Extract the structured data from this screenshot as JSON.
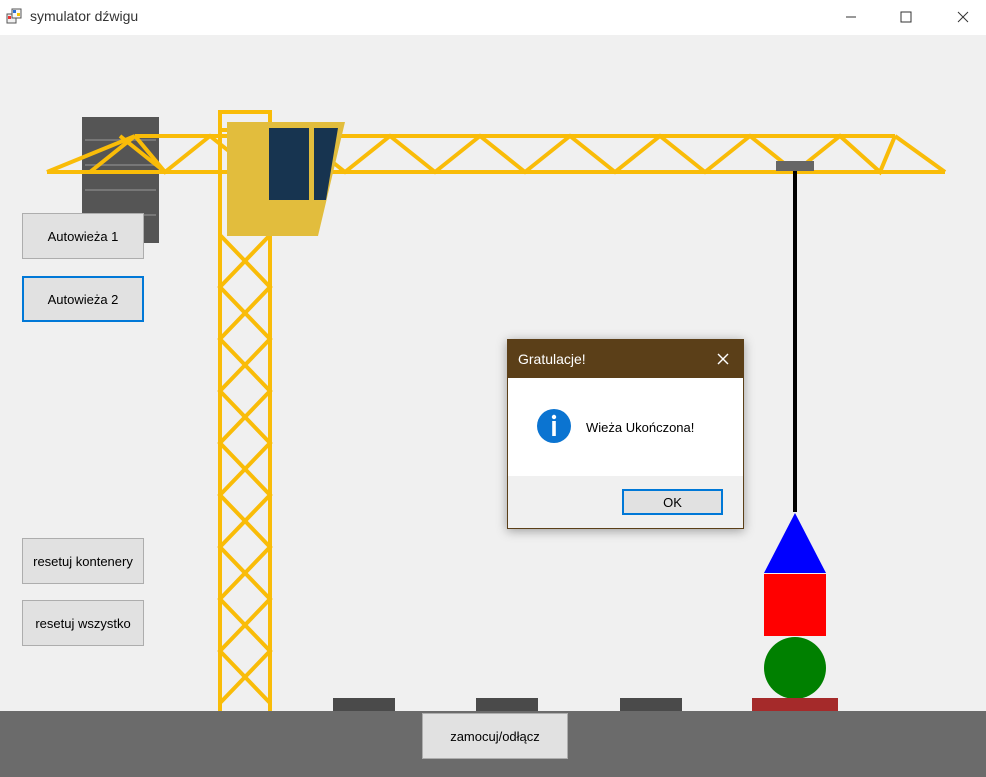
{
  "window": {
    "title": "symulator dźwigu"
  },
  "buttons": {
    "autotower1": "Autowieża 1",
    "autotower2": "Autowieża 2",
    "reset_containers": "resetuj kontenery",
    "reset_all": "resetuj wszystko",
    "attach_detach": "zamocuj/odłącz"
  },
  "dialog": {
    "title": "Gratulacje!",
    "message": "Wieża Ukończona!",
    "ok_label": "OK"
  },
  "colors": {
    "crane": "#f9bc08",
    "cab": "#e2bd3d",
    "cab_window": "#173450",
    "ground": "#6b6b6b",
    "dialog_title_bg": "#5b3f18",
    "triangle": "#0000ff",
    "square": "#ff0000",
    "circle": "#008000",
    "base": "#a52a2a"
  }
}
